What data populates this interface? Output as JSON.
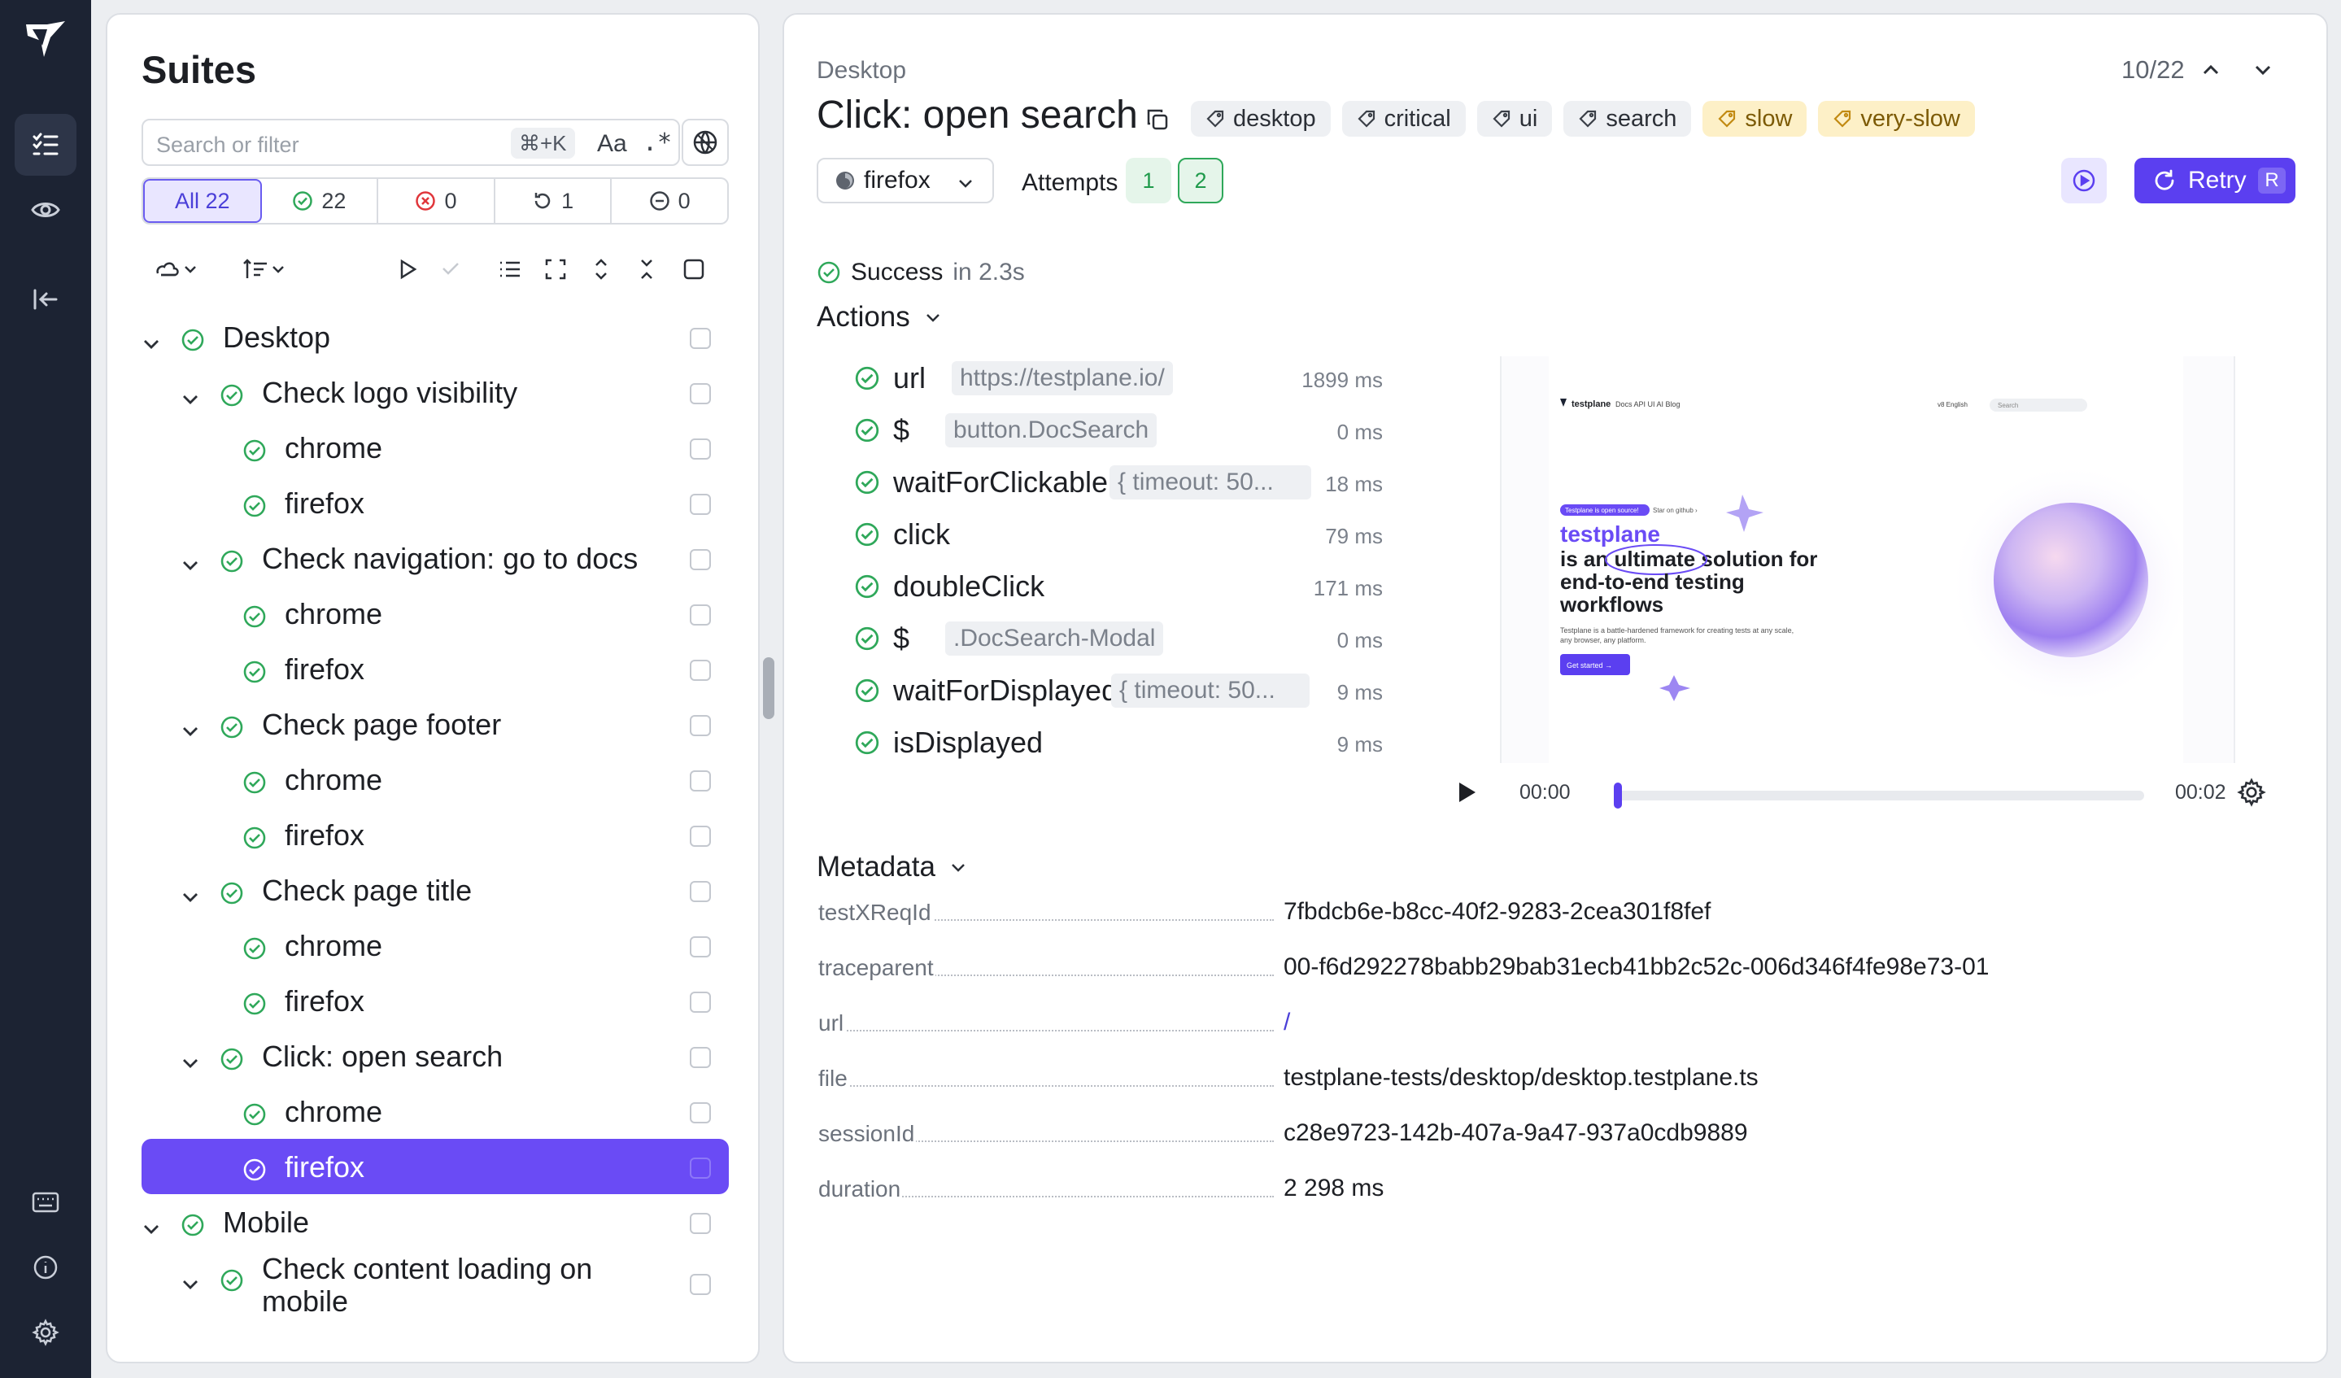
{
  "sidebar_panel": {
    "title": "Suites",
    "search_placeholder": "Search or filter",
    "search_shortcut": "⌘+K",
    "match_case_label": "Aa",
    "regex_label": ".*",
    "filter_tabs": [
      {
        "label": "All 22",
        "icon": "none"
      },
      {
        "label": "22",
        "icon": "success-icon"
      },
      {
        "label": "0",
        "icon": "error-icon"
      },
      {
        "label": "1",
        "icon": "retry-icon"
      },
      {
        "label": "0",
        "icon": "skipped-icon"
      }
    ],
    "tree": [
      {
        "label": "Desktop",
        "level": 0,
        "expandable": true
      },
      {
        "label": "Check logo visibility",
        "level": 1,
        "expandable": true
      },
      {
        "label": "chrome",
        "level": 2
      },
      {
        "label": "firefox",
        "level": 2
      },
      {
        "label": "Check navigation: go to docs",
        "level": 1,
        "expandable": true
      },
      {
        "label": "chrome",
        "level": 2
      },
      {
        "label": "firefox",
        "level": 2
      },
      {
        "label": "Check page footer",
        "level": 1,
        "expandable": true
      },
      {
        "label": "chrome",
        "level": 2
      },
      {
        "label": "firefox",
        "level": 2
      },
      {
        "label": "Check page title",
        "level": 1,
        "expandable": true
      },
      {
        "label": "chrome",
        "level": 2
      },
      {
        "label": "firefox",
        "level": 2
      },
      {
        "label": "Click: open search",
        "level": 1,
        "expandable": true
      },
      {
        "label": "chrome",
        "level": 2
      },
      {
        "label": "firefox",
        "level": 2,
        "selected": true
      },
      {
        "label": "Mobile",
        "level": 0,
        "expandable": true
      },
      {
        "label": "Check content loading on",
        "label2": "mobile",
        "level": 1,
        "expandable": true
      }
    ]
  },
  "detail": {
    "breadcrumb": "Desktop",
    "counter": "10/22",
    "title": "Click: open search",
    "tags": [
      {
        "label": "desktop",
        "warn": false
      },
      {
        "label": "critical",
        "warn": false
      },
      {
        "label": "ui",
        "warn": false
      },
      {
        "label": "search",
        "warn": false
      },
      {
        "label": "slow",
        "warn": true
      },
      {
        "label": "very-slow",
        "warn": true
      }
    ],
    "browser": "firefox",
    "attempts_label": "Attempts",
    "attempts": [
      "1",
      "2"
    ],
    "retry_label": "Retry",
    "retry_key": "R",
    "status_label": "Success",
    "status_time": "in 2.3s",
    "actions_title": "Actions",
    "actions": [
      {
        "name": "url",
        "arg": "https://testplane.io/",
        "ms": "1899 ms"
      },
      {
        "name": "$",
        "arg": "button.DocSearch",
        "ms": "0 ms"
      },
      {
        "name": "waitForClickable",
        "arg": "{ timeout: 50...",
        "ms": "18 ms"
      },
      {
        "name": "click",
        "arg": "",
        "ms": "79 ms"
      },
      {
        "name": "doubleClick",
        "arg": "",
        "ms": "171 ms"
      },
      {
        "name": "$",
        "arg": ".DocSearch-Modal",
        "ms": "0 ms"
      },
      {
        "name": "waitForDisplayed",
        "arg": "{ timeout: 50...",
        "ms": "9 ms"
      },
      {
        "name": "isDisplayed",
        "arg": "",
        "ms": "9 ms"
      }
    ],
    "player": {
      "current": "00:00",
      "total": "00:02",
      "progress": 0
    },
    "screenshot": {
      "brand": "testplane",
      "nav": [
        "Docs",
        "API",
        "UI",
        "AI",
        "Blog"
      ],
      "nav_right": [
        "v8",
        "English"
      ],
      "search": "Search",
      "badge": "Testplane is open source!",
      "badge2": "Star on github",
      "hero_brand": "testplane",
      "hero_line1a": "is an",
      "hero_line1b": "ultimate",
      "hero_line1c": "solution for",
      "hero_line2": "end-to-end testing",
      "hero_line3": "workflows",
      "sub": "Testplane is a battle-hardened framework for creating tests at any scale, any browser, any platform.",
      "cta": "Get started →"
    },
    "metadata_title": "Metadata",
    "metadata": [
      {
        "key": "testXReqId",
        "value": "7fbdcb6e-b8cc-40f2-9283-2cea301f8fef",
        "link": false
      },
      {
        "key": "traceparent",
        "value": "00-f6d292278babb29bab31ecb41bb2c52c-006d346f4fe98e73-01",
        "link": false
      },
      {
        "key": "url",
        "value": "/",
        "link": true
      },
      {
        "key": "file",
        "value": "testplane-tests/desktop/desktop.testplane.ts",
        "link": false
      },
      {
        "key": "sessionId",
        "value": "c28e9723-142b-407a-9a47-937a0cdb9889",
        "link": false
      },
      {
        "key": "duration",
        "value": "2 298 ms",
        "link": false
      }
    ]
  },
  "colors": {
    "accent": "#5b3ff0",
    "success": "#2fa85a",
    "rail": "#1c2333",
    "warn_tag": "#fdf0c7"
  }
}
